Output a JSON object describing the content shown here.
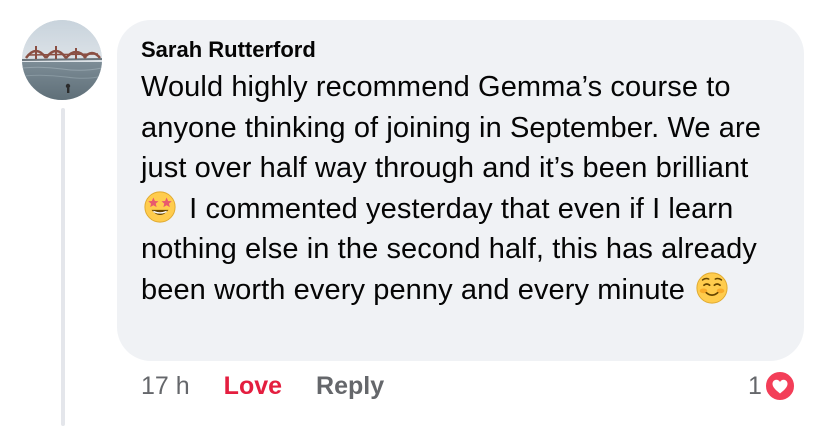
{
  "comment": {
    "author": "Sarah Rutterford",
    "text_part1": "Would highly recommend Gemma’s course to anyone thinking of joining in September. We are just over half way through and it’s been brilliant",
    "emoji1_icon": "star-struck-emoji-icon",
    "text_part2": "I commented yesterday that even if I learn nothing else in the second half, this has already been worth every penny and every minute",
    "emoji2_icon": "smiling-face-emoji-icon"
  },
  "actions": {
    "timestamp": "17 h",
    "love_label": "Love",
    "reply_label": "Reply"
  },
  "reactions": {
    "count": "1",
    "type_icon": "love-heart-icon",
    "color": "#f33e58"
  },
  "colors": {
    "bubble_bg": "#f0f2f5",
    "love_active": "#e41e3f",
    "secondary_text": "#65676b"
  }
}
